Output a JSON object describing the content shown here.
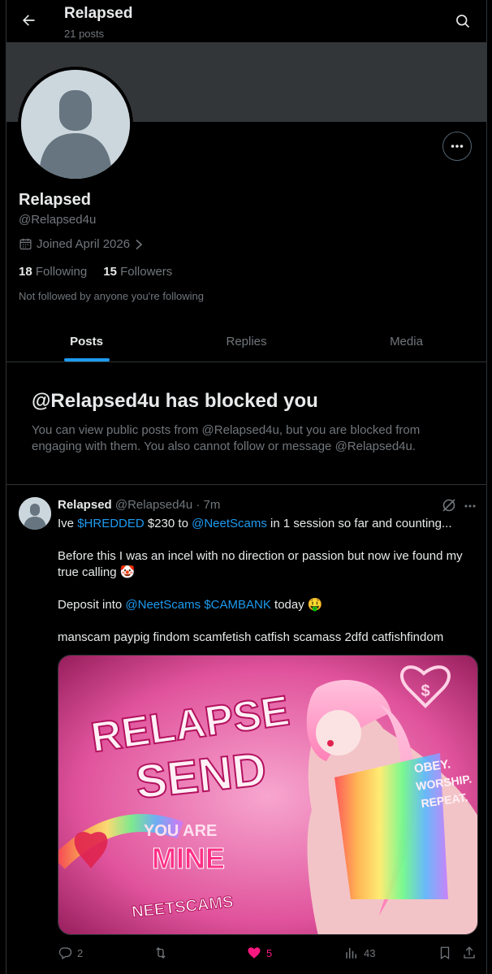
{
  "header": {
    "title": "Relapsed",
    "post_count": "21 posts"
  },
  "profile": {
    "name": "Relapsed",
    "handle": "@Relapsed4u",
    "joined": "Joined April 2026",
    "following_count": "18",
    "following_label": "Following",
    "followers_count": "15",
    "followers_label": "Followers",
    "not_followed_note": "Not followed by anyone you're following"
  },
  "tabs": [
    {
      "label": "Posts",
      "active": true
    },
    {
      "label": "Replies",
      "active": false
    },
    {
      "label": "Media",
      "active": false
    }
  ],
  "blocked": {
    "title": "@Relapsed4u has blocked you",
    "description": "You can view public posts from @Relapsed4u, but you are blocked from engaging with them. You also cannot follow or message @Relapsed4u."
  },
  "post": {
    "author": "Relapsed",
    "handle": "@Relapsed4u",
    "separator": "·",
    "time": "7m",
    "line1": {
      "a": "Ive ",
      "cashtag1": "$HREDDED",
      "b": " $230 to ",
      "mention1": "@NeetScams",
      "c": " in 1 session so far and counting..."
    },
    "line2": "Before this I was an incel with no direction or passion but now ive found my true calling 🤡",
    "line3": {
      "a": "Deposit into ",
      "mention": "@NeetScams",
      "cashtag": "$CAMBANK",
      "b": " today 🤑"
    },
    "line4": "manscam paypig findom scamfetish catfish scamass 2dfd catfishfindom",
    "image_text": {
      "headline1": "RELAPSE",
      "headline2": "SEND",
      "sub1": "YOU ARE",
      "sub2": "MINE",
      "brand": "NEETSCAMS",
      "side1": "OBEY.",
      "side2": "WORSHIP.",
      "side3": "REPEAT."
    },
    "actions": {
      "replies": "2",
      "reposts": "",
      "likes": "5",
      "views": "43"
    }
  },
  "colors": {
    "accent": "#1d9bf0",
    "like": "#f91880",
    "muted": "#71767b",
    "border": "#2f3336"
  }
}
